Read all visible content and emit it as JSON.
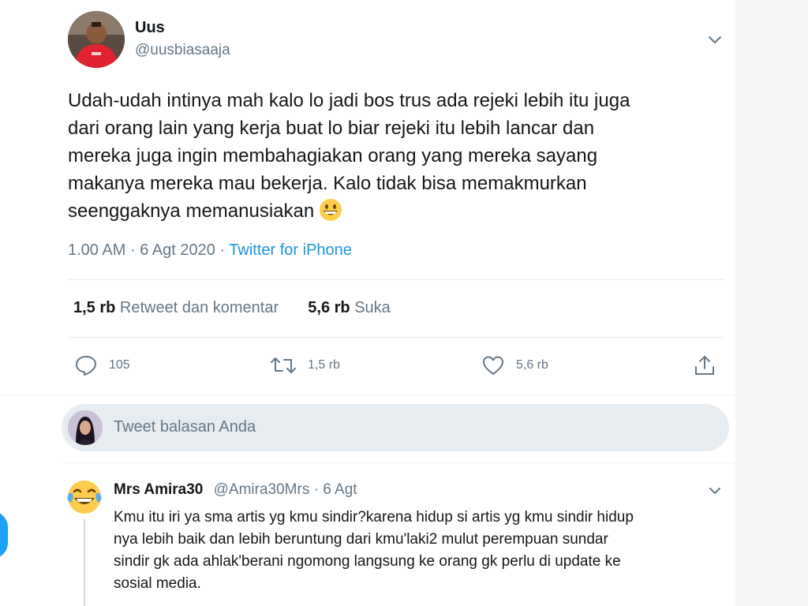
{
  "tweet": {
    "display_name": "Uus",
    "handle": "@uusbiasaaja",
    "text_lines": [
      "Udah-udah intinya mah kalo lo jadi bos trus ada rejeki lebih itu juga",
      "dari orang lain yang kerja buat lo biar rejeki itu lebih lancar dan",
      "mereka juga ingin membahagiakan orang yang mereka sayang",
      "makanya mereka mau bekerja. Kalo tidak bisa memakmurkan",
      "seenggaknya memanusiakan"
    ],
    "emoji": "grinning-face-icon",
    "time": "1.00 AM",
    "separator": "·",
    "date": "6 Agt 2020",
    "source": "Twitter for iPhone"
  },
  "stats": {
    "retweets_count": "1,5 rb",
    "retweets_label": "Retweet dan komentar",
    "likes_count": "5,6 rb",
    "likes_label": "Suka"
  },
  "actions": {
    "reply_count": "105",
    "retweet_count": "1,5 rb",
    "like_count": "5,6 rb"
  },
  "reply_box": {
    "placeholder": "Tweet balasan Anda"
  },
  "reply": {
    "name": "Mrs Amira30",
    "handle": "@Amira30Mrs",
    "separator": "·",
    "date": "6 Agt",
    "emoji_avatar": "face-with-tears-of-joy-icon",
    "text_lines": [
      "Kmu itu iri ya sma artis yg kmu sindir?karena hidup si artis yg kmu sindir hidup",
      "nya lebih baik dan lebih beruntung dari kmu'laki2 mulut perempuan sundar",
      "sindir gk ada ahlak'berani ngomong langsung ke orang gk perlu di update ke",
      "sosial media."
    ]
  },
  "colors": {
    "accent": "#1da1f2",
    "link": "#1b95e0",
    "muted": "#657786",
    "text": "#14171a",
    "divider": "#e6ecf0"
  }
}
